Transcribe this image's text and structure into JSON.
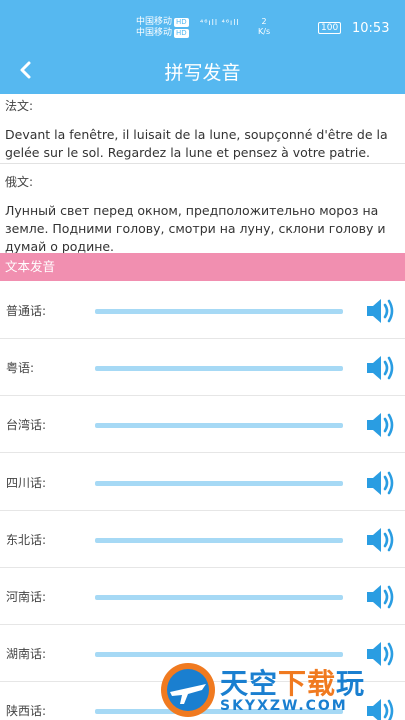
{
  "status_bar": {
    "carrier1": "中国移动",
    "carrier2": "中国移动",
    "hd": "HD",
    "signal": "⁴⁶ıll ⁴⁶ıll",
    "speed_value": "2",
    "speed_unit": "K/s",
    "battery": "100",
    "time": "10:53"
  },
  "header": {
    "title": "拼写发音"
  },
  "french": {
    "label": "法文:",
    "text": "Devant la fenêtre, il luisait de la lune, soupçonné d'être de la gelée sur le sol. Regardez la lune et pensez à votre patrie."
  },
  "russian": {
    "label": "俄文:",
    "text": "Лунный свет перед окном, предположительно мороз на земле. Подними голову, смотри на луну, склони голову и думай о родине."
  },
  "pronunciation_header": "文本发音",
  "dialects": [
    {
      "name": "普通话:",
      "progress": 1.0
    },
    {
      "name": "粤语:",
      "progress": 1.0
    },
    {
      "name": "台湾话:",
      "progress": 1.0
    },
    {
      "name": "四川话:",
      "progress": 1.0
    },
    {
      "name": "东北话:",
      "progress": 1.0
    },
    {
      "name": "河南话:",
      "progress": 1.0
    },
    {
      "name": "湖南话:",
      "progress": 1.0
    },
    {
      "name": "陕西话:",
      "progress": 1.0
    }
  ],
  "watermark": {
    "text_blue": "天空",
    "text_orange": "下载",
    "text_end": "玩",
    "url": "SKYXZW.COM"
  },
  "colors": {
    "primary": "#56b8f0",
    "pink": "#f18fb0",
    "track": "#a6d9f5",
    "speaker": "#2a9de2"
  }
}
